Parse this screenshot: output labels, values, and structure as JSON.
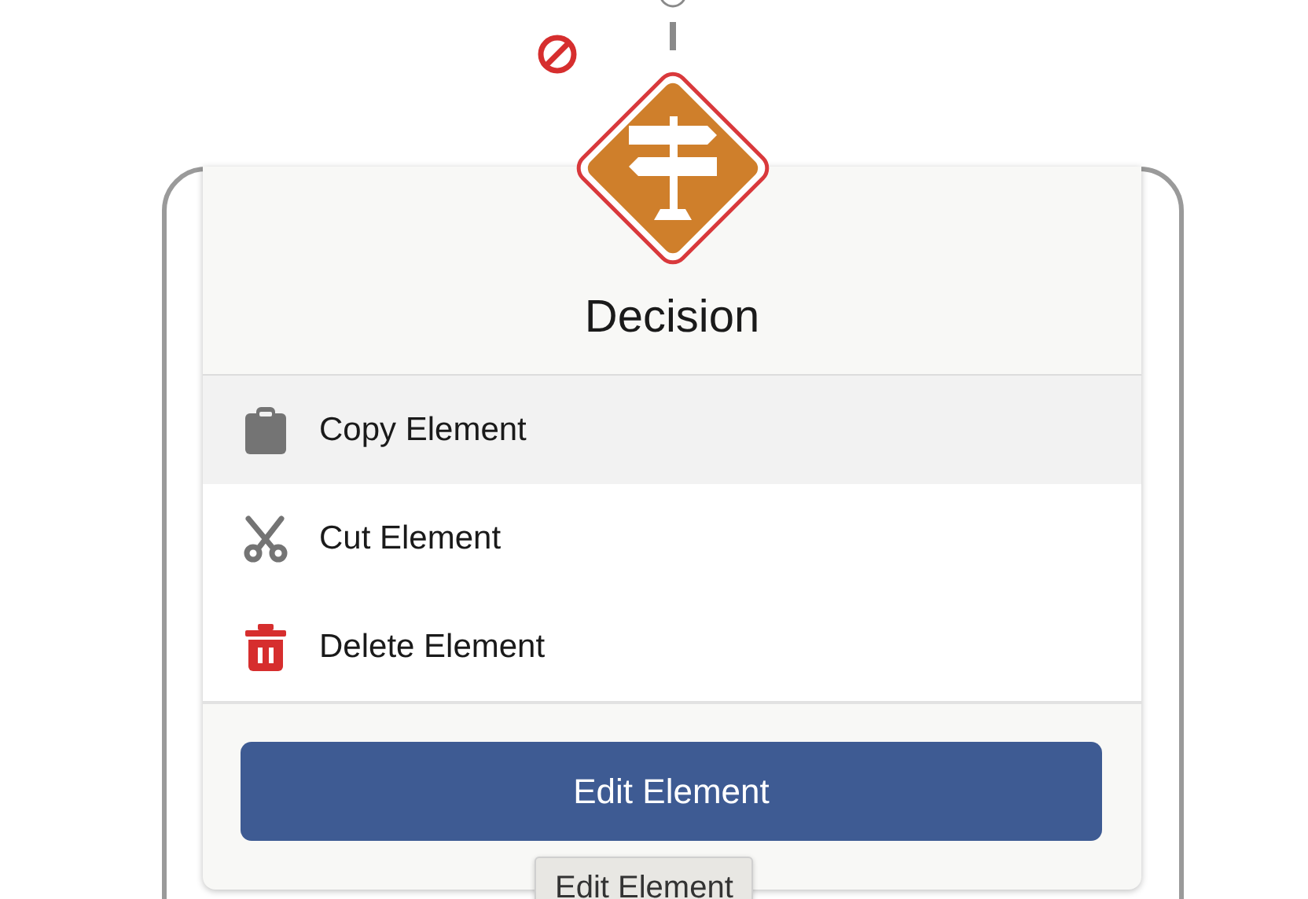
{
  "node": {
    "label": "Decision"
  },
  "menu": [
    {
      "kind": "copy",
      "label": "Copy Element",
      "selected": true
    },
    {
      "kind": "cut",
      "label": "Cut Element",
      "selected": false
    },
    {
      "kind": "delete",
      "label": "Delete Element",
      "selected": false
    }
  ],
  "edit_button": "Edit Element",
  "tooltip": "Edit Element"
}
